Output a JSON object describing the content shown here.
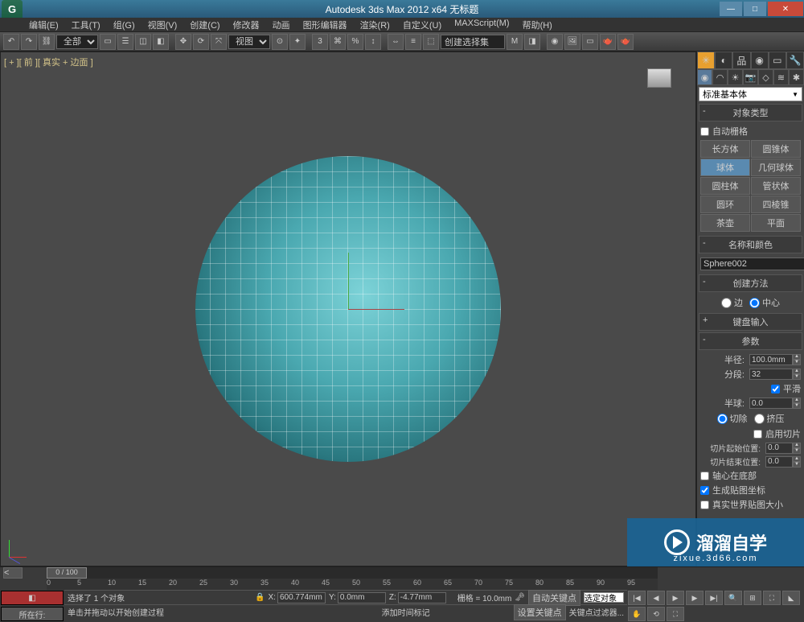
{
  "title": "Autodesk 3ds Max 2012 x64   无标题",
  "menu": [
    "编辑(E)",
    "工具(T)",
    "组(G)",
    "视图(V)",
    "创建(C)",
    "修改器",
    "动画",
    "图形编辑器",
    "渲染(R)",
    "自定义(U)",
    "MAXScript(M)",
    "帮助(H)"
  ],
  "toolbar": {
    "filter": "全部",
    "selset": "创建选择集"
  },
  "viewport": {
    "label": "[ + ][ 前 ][ 真实 + 边面 ]"
  },
  "panel": {
    "dropdown": "标准基本体",
    "objtype_head": "对象类型",
    "autogrid": "自动栅格",
    "types": [
      [
        "长方体",
        "圆锥体"
      ],
      [
        "球体",
        "几何球体"
      ],
      [
        "圆柱体",
        "管状体"
      ],
      [
        "圆环",
        "四棱锥"
      ],
      [
        "茶壶",
        "平面"
      ]
    ],
    "active_type": "球体",
    "namecolor_head": "名称和颜色",
    "name": "Sphere002",
    "method_head": "创建方法",
    "method_edge": "边",
    "method_center": "中心",
    "kbd_head": "键盘输入",
    "params_head": "参数",
    "radius_lbl": "半径:",
    "radius_val": "100.0mm",
    "seg_lbl": "分段:",
    "seg_val": "32",
    "smooth": "平滑",
    "hemi_lbl": "半球:",
    "hemi_val": "0.0",
    "chop": "切除",
    "squash": "挤压",
    "slice_on": "启用切片",
    "slice_from_lbl": "切片起始位置:",
    "slice_from_val": "0.0",
    "slice_to_lbl": "切片结束位置:",
    "slice_to_val": "0.0",
    "base_pivot": "轴心在底部",
    "gen_uv": "生成贴图坐标",
    "real_world": "真实世界贴图大小"
  },
  "timeline": {
    "range": "0 / 100",
    "ticks": [
      "0",
      "5",
      "10",
      "15",
      "20",
      "25",
      "30",
      "35",
      "40",
      "45",
      "50",
      "55",
      "60",
      "65",
      "70",
      "75",
      "80",
      "85",
      "90",
      "95"
    ]
  },
  "status": {
    "location_btn": "所在行:",
    "sel_text": "选择了 1 个对象",
    "hint": "单击并拖动以开始创建过程",
    "x_lbl": "X:",
    "x_val": "600.774mm",
    "y_lbl": "Y:",
    "y_val": "0.0mm",
    "z_lbl": "Z:",
    "z_val": "-4.77mm",
    "grid_lbl": "栅格 = 10.0mm",
    "autokey": "自动关键点",
    "selset2": "选定对象",
    "setkey": "设置关键点",
    "keyfilter": "关键点过滤器...",
    "addtime": "添加时间标记"
  },
  "watermark": {
    "main": "溜溜自学",
    "sub": "zixue.3d66.com"
  }
}
